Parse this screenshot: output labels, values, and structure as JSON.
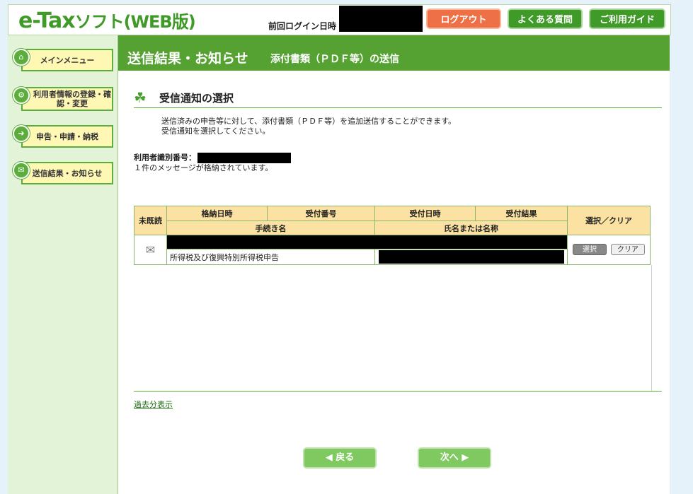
{
  "header": {
    "logo_main": "e-Tax",
    "logo_sub": "ソフト(WEB版)",
    "last_login_label": "前回ログイン日時",
    "logout_label": "ログアウト",
    "faq_label": "よくある質問",
    "guide_label": "ご利用ガイド"
  },
  "sidebar": {
    "items": [
      {
        "label": "メインメニュー",
        "icon": "home-icon"
      },
      {
        "label": "利用者情報の登録・確認・変更",
        "icon": "gear-icon"
      },
      {
        "label": "申告・申請・納税",
        "icon": "arrow-right-icon"
      },
      {
        "label": "送信結果・お知らせ",
        "icon": "mail-icon"
      }
    ]
  },
  "page": {
    "title": "送信結果・お知らせ",
    "subtitle": "添付書類（ＰＤＦ等）の送信",
    "section_title": "受信通知の選択",
    "desc_line1": "送信済みの申告等に対して、添付書類（ＰＤＦ等）を追加送信することができます。",
    "desc_line2": "受信通知を選択してください。",
    "user_id_label": "利用者識別番号：",
    "message_count": "１件のメッセージが格納されています。"
  },
  "table": {
    "headers": {
      "unread": "未既読",
      "stored_at": "格納日時",
      "receipt_no": "受付番号",
      "received_at": "受付日時",
      "result": "受付結果",
      "select_clear": "選択／クリア",
      "procedure": "手続き名",
      "name": "氏名または名称"
    },
    "rows": [
      {
        "procedure": "所得税及び復興特別所得税申告",
        "select_label": "選択",
        "clear_label": "クリア"
      }
    ]
  },
  "footer": {
    "past_link": "過去分表示",
    "back_label": "戻る",
    "next_label": "次へ"
  },
  "colors": {
    "brand_green": "#55a232",
    "logout_orange": "#ee7046",
    "header_cell": "#fbe2a3"
  }
}
